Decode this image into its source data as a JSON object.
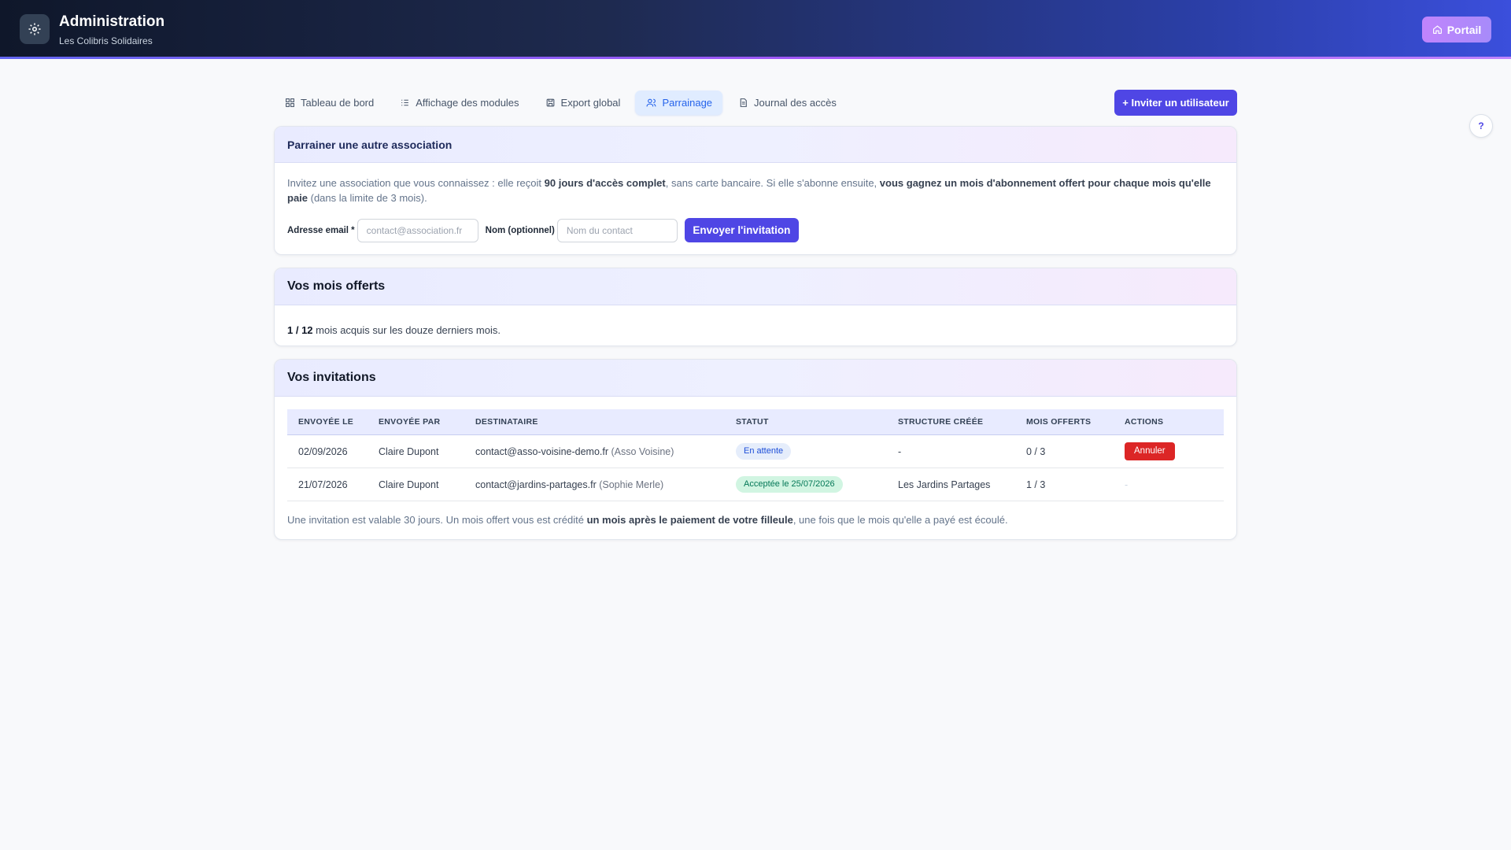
{
  "header": {
    "title": "Administration",
    "subtitle": "Les Colibris Solidaires",
    "portal_label": "Portail"
  },
  "tabs": [
    {
      "label": "Tableau de bord",
      "icon": "dashboard-icon",
      "active": false
    },
    {
      "label": "Affichage des modules",
      "icon": "list-icon",
      "active": false
    },
    {
      "label": "Export global",
      "icon": "save-icon",
      "active": false
    },
    {
      "label": "Parrainage",
      "icon": "users-icon",
      "active": true
    },
    {
      "label": "Journal des accès",
      "icon": "document-icon",
      "active": false
    }
  ],
  "invite_user_label": "+ Inviter un utilisateur",
  "help_label": "?",
  "referral": {
    "title": "Parrainer une autre association",
    "intro_1": "Invitez une association que vous connaissez : elle reçoit ",
    "intro_bold_1": "90 jours d'accès complet",
    "intro_2": ", sans carte bancaire. Si elle s'abonne ensuite, ",
    "intro_bold_2": "vous gagnez un mois d'abonnement offert pour chaque mois qu'elle paie",
    "intro_3": " (dans la limite de 3 mois).",
    "email_label": "Adresse email *",
    "email_placeholder": "contact@association.fr",
    "name_label": "Nom (optionnel)",
    "name_placeholder": "Nom du contact",
    "send_label": "Envoyer l'invitation"
  },
  "months": {
    "title": "Vos mois offerts",
    "count": "1 / 12",
    "text": " mois acquis sur les douze derniers mois."
  },
  "invitations": {
    "title": "Vos invitations",
    "columns": [
      "ENVOYÉE LE",
      "ENVOYÉE PAR",
      "DESTINATAIRE",
      "STATUT",
      "STRUCTURE CRÉÉE",
      "MOIS OFFERTS",
      "ACTIONS"
    ],
    "rows": [
      {
        "date": "02/09/2026",
        "sender": "Claire Dupont",
        "email": "contact@asso-voisine-demo.fr",
        "contact": " (Asso Voisine)",
        "status": "En attente",
        "structure": "-",
        "months": "0 / 3",
        "action": "Annuler"
      },
      {
        "date": "21/07/2026",
        "sender": "Claire Dupont",
        "email": "contact@jardins-partages.fr",
        "contact": " (Sophie Merle)",
        "status": "Acceptée le 25/07/2026",
        "structure": "Les Jardins Partages",
        "months": "1 / 3",
        "action": "-"
      }
    ],
    "foot_1": "Une invitation est valable 30 jours. Un mois offert vous est crédité ",
    "foot_bold": "un mois après le paiement de votre filleule",
    "foot_2": ", une fois que le mois qu'elle a payé est écoulé."
  },
  "colors": {
    "accent": "#4f46e5",
    "pending": "#1d4ed8",
    "accepted": "#047857",
    "danger": "#dc2626"
  }
}
